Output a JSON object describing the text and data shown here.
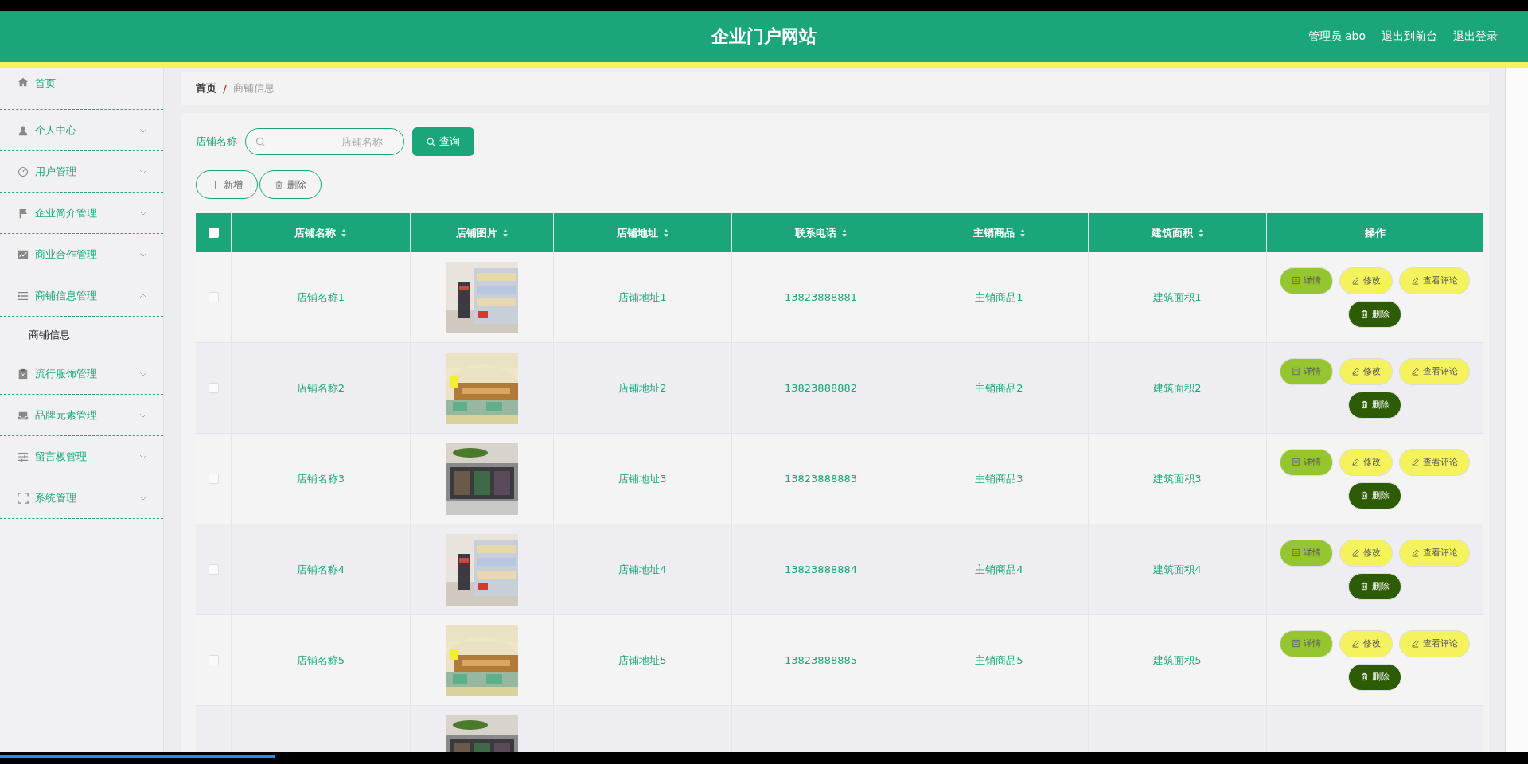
{
  "header": {
    "title": "企业门户网站",
    "user": "管理员 abo",
    "links": [
      "退出到前台",
      "退出登录"
    ]
  },
  "sidebar": {
    "items": [
      {
        "label": "首页",
        "kind": "link"
      },
      {
        "label": "个人中心",
        "kind": "menu",
        "expanded": false
      },
      {
        "label": "用户管理",
        "kind": "menu",
        "expanded": false
      },
      {
        "label": "企业简介管理",
        "kind": "menu",
        "expanded": false
      },
      {
        "label": "商业合作管理",
        "kind": "menu",
        "expanded": false
      },
      {
        "label": "商铺信息管理",
        "kind": "menu",
        "expanded": true,
        "children": [
          {
            "label": "商铺信息"
          }
        ]
      },
      {
        "label": "流行服饰管理",
        "kind": "menu",
        "expanded": false
      },
      {
        "label": "品牌元素管理",
        "kind": "menu",
        "expanded": false
      },
      {
        "label": "留言板管理",
        "kind": "menu",
        "expanded": false
      },
      {
        "label": "系统管理",
        "kind": "menu",
        "expanded": false
      }
    ]
  },
  "breadcrumb": {
    "items": [
      "首页",
      "商铺信息"
    ],
    "separator": "/"
  },
  "search": {
    "label": "店铺名称",
    "placeholder": "店铺名称",
    "button": "查询"
  },
  "actions": [
    {
      "label": "新增",
      "kind": "add"
    },
    {
      "label": "删除",
      "kind": "delete"
    }
  ],
  "table": {
    "all_checked": false,
    "columns": [
      {
        "label": "店铺名称",
        "sortable": true
      },
      {
        "label": "店铺图片",
        "sortable": true
      },
      {
        "label": "店铺地址",
        "sortable": true
      },
      {
        "label": "联系电话",
        "sortable": true
      },
      {
        "label": "主销商品",
        "sortable": true
      },
      {
        "label": "建筑面积",
        "sortable": true
      },
      {
        "label": "操作",
        "sortable": false
      }
    ],
    "rows": [
      {
        "checked": false,
        "name": "店铺名称1",
        "image": {
          "kind": "picture"
        },
        "address": "店铺地址1",
        "phone": "13823888881",
        "product": "主销商品1",
        "area": "建筑面积1",
        "actions": [
          {
            "label": "详情",
            "kind": "detail"
          },
          {
            "label": "修改",
            "kind": "edit"
          },
          {
            "label": "查看评论",
            "kind": "comments"
          },
          {
            "label": "删除",
            "kind": "delete"
          }
        ]
      },
      {
        "checked": false,
        "name": "店铺名称2",
        "image": {
          "kind": "picture"
        },
        "address": "店铺地址2",
        "phone": "13823888882",
        "product": "主销商品2",
        "area": "建筑面积2",
        "actions": [
          {
            "label": "详情",
            "kind": "detail"
          },
          {
            "label": "修改",
            "kind": "edit"
          },
          {
            "label": "查看评论",
            "kind": "comments"
          },
          {
            "label": "删除",
            "kind": "delete"
          }
        ]
      },
      {
        "checked": false,
        "name": "店铺名称3",
        "image": {
          "kind": "picture"
        },
        "address": "店铺地址3",
        "phone": "13823888883",
        "product": "主销商品3",
        "area": "建筑面积3",
        "actions": [
          {
            "label": "详情",
            "kind": "detail"
          },
          {
            "label": "修改",
            "kind": "edit"
          },
          {
            "label": "查看评论",
            "kind": "comments"
          },
          {
            "label": "删除",
            "kind": "delete"
          }
        ]
      },
      {
        "checked": false,
        "name": "店铺名称4",
        "image": {
          "kind": "picture"
        },
        "address": "店铺地址4",
        "phone": "13823888884",
        "product": "主销商品4",
        "area": "建筑面积4",
        "actions": [
          {
            "label": "详情",
            "kind": "detail"
          },
          {
            "label": "修改",
            "kind": "edit"
          },
          {
            "label": "查看评论",
            "kind": "comments"
          },
          {
            "label": "删除",
            "kind": "delete"
          }
        ]
      },
      {
        "checked": false,
        "name": "店铺名称5",
        "image": {
          "kind": "picture"
        },
        "address": "店铺地址5",
        "phone": "13823888885",
        "product": "主销商品5",
        "area": "建筑面积5",
        "actions": [
          {
            "label": "详情",
            "kind": "detail"
          },
          {
            "label": "修改",
            "kind": "edit"
          },
          {
            "label": "查看评论",
            "kind": "comments"
          },
          {
            "label": "删除",
            "kind": "delete"
          }
        ]
      },
      {
        "image": {
          "kind": "picture"
        }
      }
    ]
  }
}
